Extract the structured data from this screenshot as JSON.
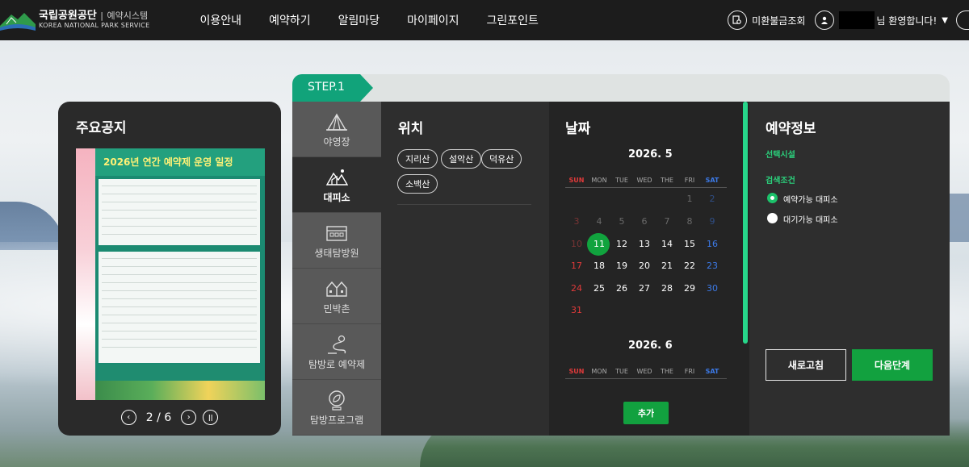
{
  "header": {
    "logo_ko": "국립공원공단",
    "logo_system": "예약시스템",
    "logo_en": "KOREA NATIONAL PARK SERVICE",
    "nav": [
      "이용안내",
      "예약하기",
      "알림마당",
      "마이페이지",
      "그린포인트"
    ],
    "refund_label": "미환불금조회",
    "welcome": "님 환영합니다!"
  },
  "notice": {
    "title": "주요공지",
    "poster_title": "2026년 연간 예약제 운영 일정",
    "page_current": "2",
    "page_sep": "/",
    "page_total": "6"
  },
  "step": {
    "label": "STEP.1"
  },
  "categories": [
    {
      "label": "야영장",
      "icon": "tent-icon"
    },
    {
      "label": "대피소",
      "icon": "shelter-icon",
      "active": true
    },
    {
      "label": "생태탐방원",
      "icon": "building-icon"
    },
    {
      "label": "민박촌",
      "icon": "houses-icon"
    },
    {
      "label": "탐방로 예약제",
      "icon": "trail-icon"
    },
    {
      "label": "탐방프로그램",
      "icon": "leaf-icon"
    }
  ],
  "location": {
    "title": "위치",
    "chips": [
      "지리산",
      "설악산",
      "덕유산",
      "소백산"
    ]
  },
  "date": {
    "title": "날짜",
    "weekdays": [
      "SUN",
      "MON",
      "TUE",
      "WED",
      "THE",
      "FRI",
      "SAT"
    ],
    "months": [
      {
        "label": "2026. 5",
        "weeks": [
          [
            "",
            "",
            "",
            "",
            "",
            "1",
            "2"
          ],
          [
            "3",
            "4",
            "5",
            "6",
            "7",
            "8",
            "9"
          ],
          [
            "10",
            "11",
            "12",
            "13",
            "14",
            "15",
            "16"
          ],
          [
            "17",
            "18",
            "19",
            "20",
            "21",
            "22",
            "23"
          ],
          [
            "24",
            "25",
            "26",
            "27",
            "28",
            "29",
            "30"
          ],
          [
            "31",
            "",
            "",
            "",
            "",
            "",
            ""
          ]
        ]
      },
      {
        "label": "2026. 6"
      }
    ],
    "add_label": "추가"
  },
  "info": {
    "title": "예약정보",
    "selected_facility": "선택시설",
    "search_condition": "검색조건",
    "options": [
      "예약가능 대피소",
      "대기가능 대피소"
    ],
    "refresh": "새로고침",
    "next": "다음단계"
  },
  "colors": {
    "accent_green": "#12a13f",
    "step_green": "#11a37a",
    "sunday_red": "#e03a3a",
    "saturday_blue": "#3c7ae8"
  }
}
